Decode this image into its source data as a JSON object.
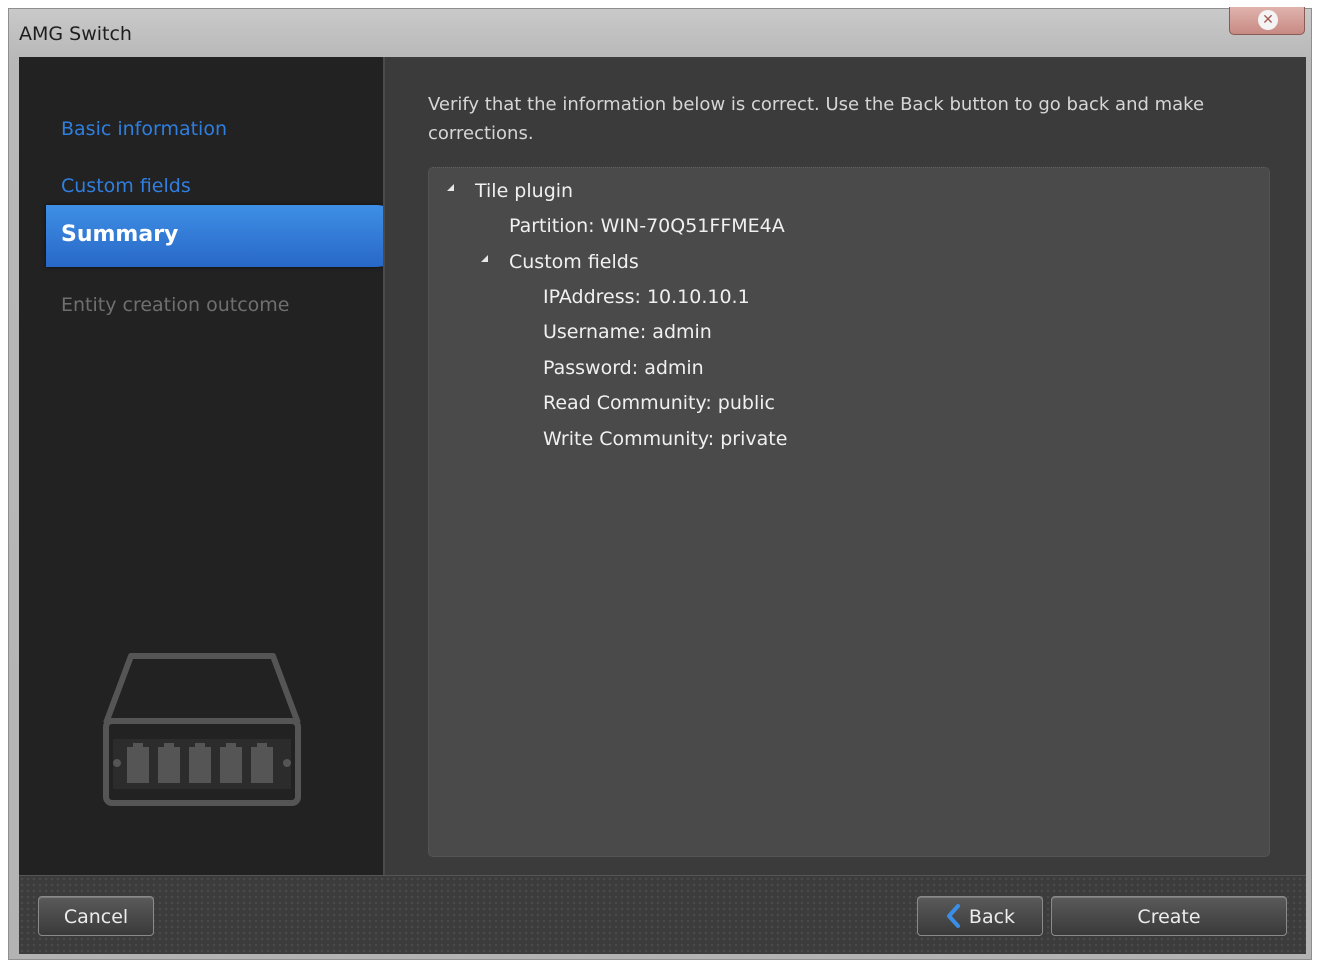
{
  "window": {
    "title": "AMG Switch",
    "close_icon": "close-icon"
  },
  "sidebar": {
    "steps": [
      {
        "label": "Basic information",
        "state": "link"
      },
      {
        "label": "Custom fields",
        "state": "link"
      },
      {
        "label": "Summary",
        "state": "active"
      },
      {
        "label": "Entity creation outcome",
        "state": "disabled"
      }
    ],
    "illustration": "network-switch-icon"
  },
  "main": {
    "instruction": "Verify that the information below is correct. Use the Back button to go back and make corrections.",
    "tree": {
      "root_label": "Tile plugin",
      "partition": "Partition: WIN-70Q51FFME4A",
      "custom_fields_label": "Custom fields",
      "fields": [
        "IPAddress: 10.10.10.1",
        "Username: admin",
        "Password: admin",
        "Read Community: public",
        "Write Community: private"
      ]
    }
  },
  "footer": {
    "cancel_label": "Cancel",
    "back_label": "Back",
    "create_label": "Create"
  },
  "colors": {
    "accent": "#2f7fe0",
    "active_step": "#3a86e0",
    "panel": "#4a4a4a",
    "sidebar": "#222222"
  }
}
